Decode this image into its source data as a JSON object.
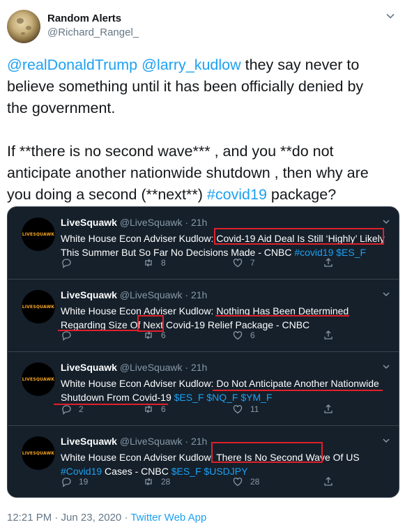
{
  "author": {
    "display_name": "Random Alerts",
    "handle": "@Richard_Rangel_"
  },
  "tweet": {
    "mention_1": "@realDonaldTrump",
    "mention_2": "@larry_kudlow",
    "line1_rest": " they say never to",
    "line2": "believe something until it has been officially denied by",
    "line3": "the government.",
    "line4": "If **there is no second wave*** , and you **do not",
    "line5": "anticipate another nationwide shutdown , then why are",
    "line6_pre": "you doing a second (**next**) ",
    "hashtag": "#covid19",
    "line6_post": " package?"
  },
  "embedded_tweets": [
    {
      "avatar_text": "LIVESQUAWK",
      "name": "LiveSquawk",
      "meta": "@LiveSquawk · 21h",
      "line1": "White House Econ Adviser Kudlow: Covid-19 Aid Deal Is Still ‘Highly’ Likely",
      "line2_text": "This Summer But So Far No Decisions Made - CNBC ",
      "line2_tags": "#covid19 $ES_F",
      "reply_count": "",
      "retweet_count": "8",
      "like_count": "7"
    },
    {
      "avatar_text": "LIVESQUAWK",
      "name": "LiveSquawk",
      "meta": "@LiveSquawk · 21h",
      "line1": "White House Econ Adviser Kudlow: Nothing Has Been Determined",
      "line2_text": "Regarding Size Of Next Covid-19 Relief Package - CNBC",
      "line2_tags": "",
      "reply_count": "",
      "retweet_count": "6",
      "like_count": "6"
    },
    {
      "avatar_text": "LIVESQUAWK",
      "name": "LiveSquawk",
      "meta": "@LiveSquawk · 21h",
      "line1": "White House Econ Adviser Kudlow: Do Not Anticipate Another Nationwide",
      "line2_text": "Shutdown From Covid-19 ",
      "line2_tags": "$ES_F $NQ_F $YM_F",
      "reply_count": "2",
      "retweet_count": "6",
      "like_count": "11"
    },
    {
      "avatar_text": "LIVESQUAWK",
      "name": "LiveSquawk",
      "meta": "@LiveSquawk · 21h",
      "line1": "White House Econ Adviser Kudlow: There Is No Second Wave Of US",
      "line2_tags_pre": "#Covid19",
      "line2_text": " Cases - CNBC ",
      "line2_tags": "$ES_F $USDJPY",
      "reply_count": "19",
      "retweet_count": "28",
      "like_count": "28"
    }
  ],
  "footer": {
    "time": "12:21 PM · Jun 23, 2020 · ",
    "app": "Twitter Web App"
  },
  "colors": {
    "link": "#1da1f2",
    "embed_bg": "#15202b",
    "highlight": "#e0202a"
  }
}
